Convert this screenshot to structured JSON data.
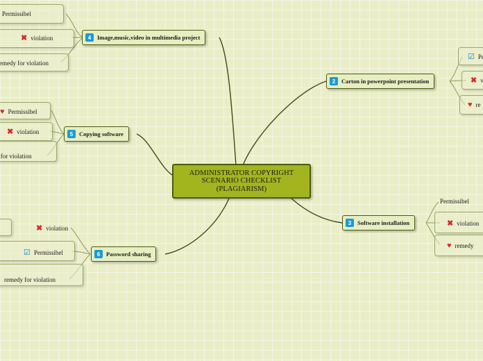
{
  "diagram": {
    "type": "mind-map",
    "central": {
      "label": "ADMINISTRATOR COPYRIGHT\nSCENARIO CHECKLIST\n(PLAGIARISM)",
      "color": "#a2b51e"
    },
    "branches": [
      {
        "number": "4",
        "label": "Image,music,video in multimedia project",
        "badge_color": "#1b9ad6"
      },
      {
        "number": "2",
        "label": "Carton in powerpoint presentation",
        "badge_color": "#1b9ad6"
      },
      {
        "number": "5",
        "label": "Copying software",
        "badge_color": "#1b9ad6"
      },
      {
        "number": "3",
        "label": "Software installation",
        "badge_color": "#1b9ad6"
      },
      {
        "number": "6",
        "label": "Password sharing",
        "badge_color": "#1b9ad6"
      }
    ],
    "leaves": {
      "top_left": [
        {
          "icon": "check-icon",
          "label": "Permissibel"
        },
        {
          "icon": "cross-icon",
          "label": "violation"
        },
        {
          "icon": "heart-icon",
          "label": "remedy for violation"
        }
      ],
      "middle_left": [
        {
          "icon": "heart-icon",
          "label": "Permissibel"
        },
        {
          "icon": "cross-icon",
          "label": "violation"
        },
        {
          "icon": "heart-icon",
          "label": "y for violation"
        }
      ],
      "bottom_left": [
        {
          "icon": "cross-icon",
          "label": "violation"
        },
        {
          "icon": "check-icon",
          "label": "Permissibel"
        },
        {
          "icon": "heart-icon",
          "label": "remedy for violation"
        }
      ],
      "top_right": [
        {
          "icon": "check-icon",
          "label": "Pe"
        },
        {
          "icon": "cross-icon",
          "label": "vi"
        },
        {
          "icon": "heart-icon",
          "label": "re"
        }
      ],
      "bottom_right": [
        {
          "icon": "none",
          "label": "Permissibel"
        },
        {
          "icon": "cross-icon",
          "label": "violation"
        },
        {
          "icon": "heart-icon",
          "label": "remedy"
        }
      ]
    },
    "icons": {
      "check": "☑",
      "cross": "✖",
      "heart": "♥"
    }
  }
}
